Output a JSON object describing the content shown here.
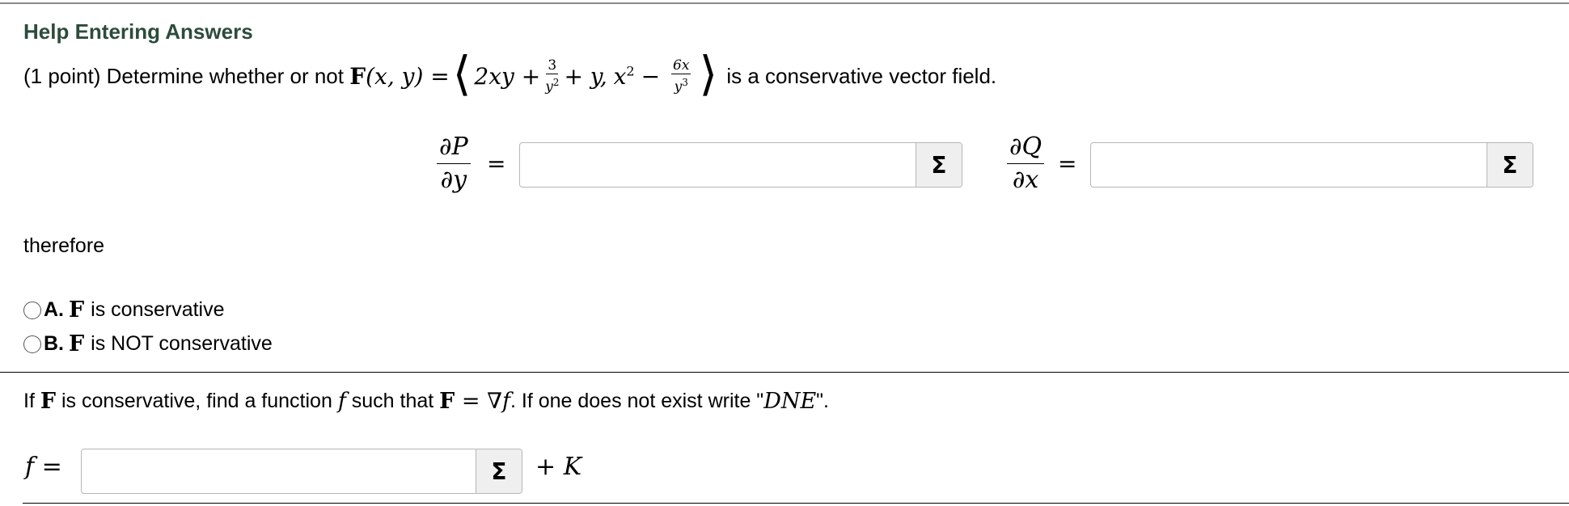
{
  "header": {
    "help_link": "Help Entering Answers"
  },
  "problem": {
    "points": "(1 point)",
    "prompt_before": "Determine whether or not",
    "field_name": "F",
    "field_args": "(x, y) =",
    "comp1_a": "2xy +",
    "comp1_frac_num": "3",
    "comp1_frac_den": "y",
    "comp1_frac_den_exp": "2",
    "comp1_b": "+ y,",
    "comp2_a": "x",
    "comp2_a_exp": "2",
    "comp2_minus": "−",
    "comp2_frac_num": "6x",
    "comp2_frac_den": "y",
    "comp2_frac_den_exp": "3",
    "langle": "⟨",
    "rangle": "⟩",
    "prompt_after": "is a conservative vector field."
  },
  "partials": {
    "dp_num": "∂P",
    "dp_den": "∂y",
    "dq_num": "∂Q",
    "dq_den": "∂x",
    "equals": "=",
    "dp_value": "",
    "dq_value": "",
    "sigma_label": "Σ"
  },
  "therefore": "therefore",
  "choices": [
    {
      "letter": "A.",
      "symbol": "F",
      "text": "is conservative",
      "selected": false
    },
    {
      "letter": "B.",
      "symbol": "F",
      "text": "is NOT conservative",
      "selected": false
    }
  ],
  "followup": {
    "p1": "If ",
    "F1": "F",
    "p2": " is conservative, find a function ",
    "f": "f",
    "p3": " such that ",
    "F2": "F",
    "eq": " = ∇",
    "f2": "f",
    "p4": ". If one does not exist write \"",
    "dne": "DNE",
    "p5": "\"."
  },
  "potential": {
    "label_f": "f",
    "label_eq": " =",
    "value": "",
    "plus_k": "+ K",
    "sigma_label": "Σ"
  },
  "colors": {
    "help_link": "#2c4c3b",
    "box_border": "#b7b7b7",
    "sigma_bg": "#efefef"
  },
  "icons": {
    "equation_editor": "sigma-icon"
  }
}
